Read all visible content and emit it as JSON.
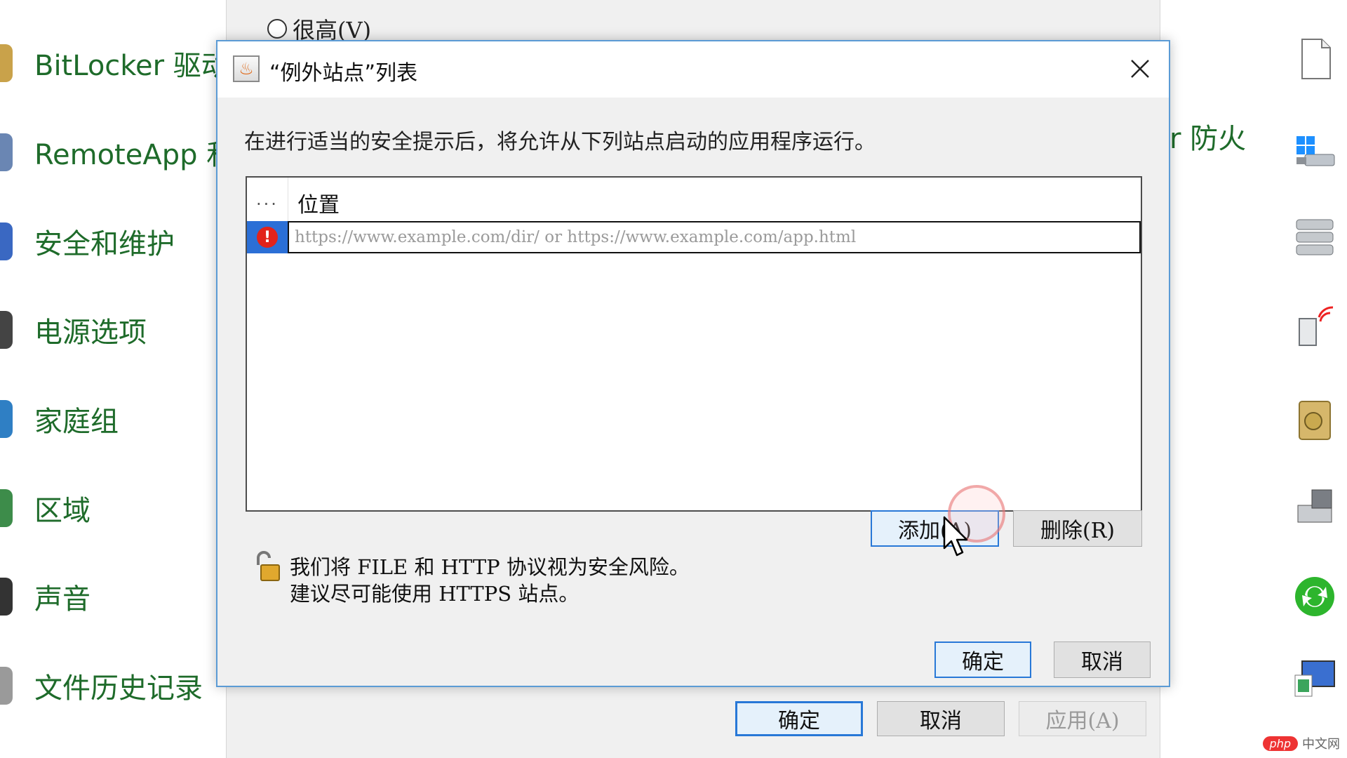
{
  "background_panel": {
    "items": [
      {
        "label": "BitLocker 驱动"
      },
      {
        "label": "RemoteApp 和"
      },
      {
        "label": "安全和维护"
      },
      {
        "label": "电源选项"
      },
      {
        "label": "家庭组"
      },
      {
        "label": "区域"
      },
      {
        "label": "声音"
      },
      {
        "label": "文件历史记录"
      }
    ],
    "partial_right_label": "r 防火"
  },
  "underlying_window": {
    "radio_label": "很高(V)",
    "ok_label": "确定",
    "cancel_label": "取消",
    "apply_label": "应用(A)"
  },
  "dialog": {
    "title": "“例外站点”列表",
    "description": "在进行适当的安全提示后，将允许从下列站点启动的应用程序运行。",
    "table": {
      "dots_header": "...",
      "location_header": "位置",
      "row_placeholder": "https://www.example.com/dir/ or https://www.example.com/app.html"
    },
    "add_label": "添加(A)",
    "remove_label": "删除(R)",
    "note_line1": "我们将 FILE 和 HTTP 协议视为安全风险。",
    "note_line2": "建议尽可能使用 HTTPS 站点。",
    "ok_label": "确定",
    "cancel_label": "取消"
  },
  "watermark": {
    "badge": "php",
    "text": "中文网"
  },
  "colors": {
    "accent": "#2878d7",
    "link_green": "#1e6b2a",
    "warning_red": "#e2231a",
    "selection_blue": "#2b6fd6"
  }
}
